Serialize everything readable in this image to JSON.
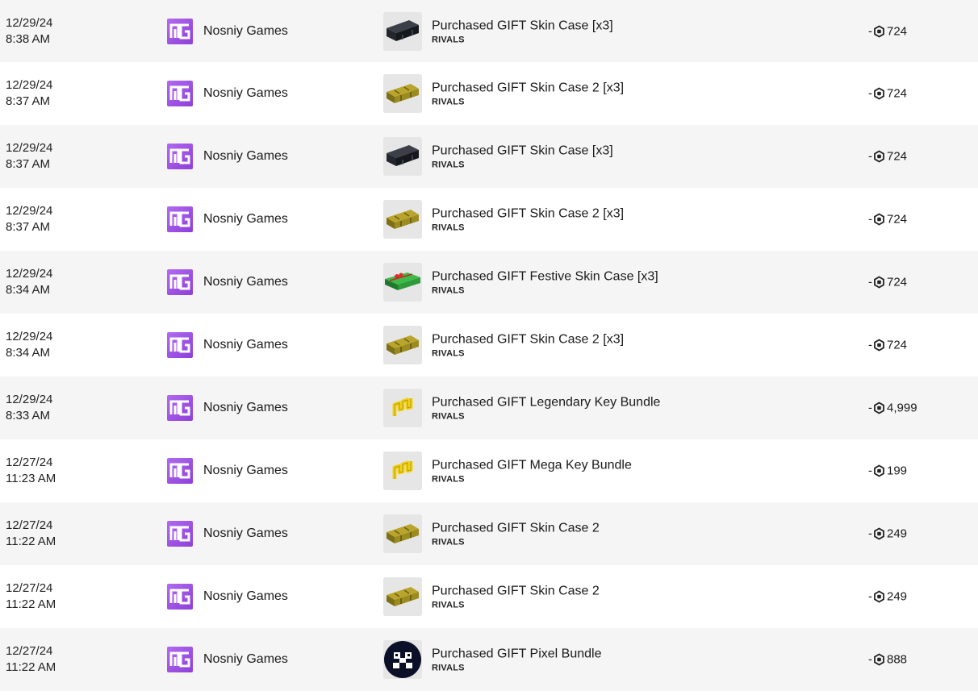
{
  "transactions": [
    {
      "date": "12/29/24",
      "time": "8:38 AM",
      "creator": "Nosniy Games",
      "description": "Purchased GIFT Skin Case [x3]",
      "game": "RIVALS",
      "sign": "-",
      "amount": "724",
      "thumbnail": "black-case-icon"
    },
    {
      "date": "12/29/24",
      "time": "8:37 AM",
      "creator": "Nosniy Games",
      "description": "Purchased GIFT Skin Case 2 [x3]",
      "game": "RIVALS",
      "sign": "-",
      "amount": "724",
      "thumbnail": "gold-case-icon"
    },
    {
      "date": "12/29/24",
      "time": "8:37 AM",
      "creator": "Nosniy Games",
      "description": "Purchased GIFT Skin Case [x3]",
      "game": "RIVALS",
      "sign": "-",
      "amount": "724",
      "thumbnail": "black-case-icon"
    },
    {
      "date": "12/29/24",
      "time": "8:37 AM",
      "creator": "Nosniy Games",
      "description": "Purchased GIFT Skin Case 2 [x3]",
      "game": "RIVALS",
      "sign": "-",
      "amount": "724",
      "thumbnail": "gold-case-icon"
    },
    {
      "date": "12/29/24",
      "time": "8:34 AM",
      "creator": "Nosniy Games",
      "description": "Purchased GIFT Festive Skin Case [x3]",
      "game": "RIVALS",
      "sign": "-",
      "amount": "724",
      "thumbnail": "festive-case-icon"
    },
    {
      "date": "12/29/24",
      "time": "8:34 AM",
      "creator": "Nosniy Games",
      "description": "Purchased GIFT Skin Case 2 [x3]",
      "game": "RIVALS",
      "sign": "-",
      "amount": "724",
      "thumbnail": "gold-case-icon"
    },
    {
      "date": "12/29/24",
      "time": "8:33 AM",
      "creator": "Nosniy Games",
      "description": "Purchased GIFT Legendary Key Bundle",
      "game": "RIVALS",
      "sign": "-",
      "amount": "4,999",
      "thumbnail": "key-bundle-icon"
    },
    {
      "date": "12/27/24",
      "time": "11:23 AM",
      "creator": "Nosniy Games",
      "description": "Purchased GIFT Mega Key Bundle",
      "game": "RIVALS",
      "sign": "-",
      "amount": "199",
      "thumbnail": "key-bundle-icon"
    },
    {
      "date": "12/27/24",
      "time": "11:22 AM",
      "creator": "Nosniy Games",
      "description": "Purchased GIFT Skin Case 2",
      "game": "RIVALS",
      "sign": "-",
      "amount": "249",
      "thumbnail": "gold-case-icon"
    },
    {
      "date": "12/27/24",
      "time": "11:22 AM",
      "creator": "Nosniy Games",
      "description": "Purchased GIFT Skin Case 2",
      "game": "RIVALS",
      "sign": "-",
      "amount": "249",
      "thumbnail": "gold-case-icon"
    },
    {
      "date": "12/27/24",
      "time": "11:22 AM",
      "creator": "Nosniy Games",
      "description": "Purchased GIFT Pixel Bundle",
      "game": "RIVALS",
      "sign": "-",
      "amount": "888",
      "thumbnail": "pixel-bundle-icon"
    }
  ],
  "colors": {
    "row_alt": "#f5f5f6",
    "creator_logo": "#a155e8",
    "gold_case": "#b9a52c",
    "black_case": "#23262c",
    "festive_case": "#2e9a3a",
    "key_yellow": "#f2d21a"
  }
}
